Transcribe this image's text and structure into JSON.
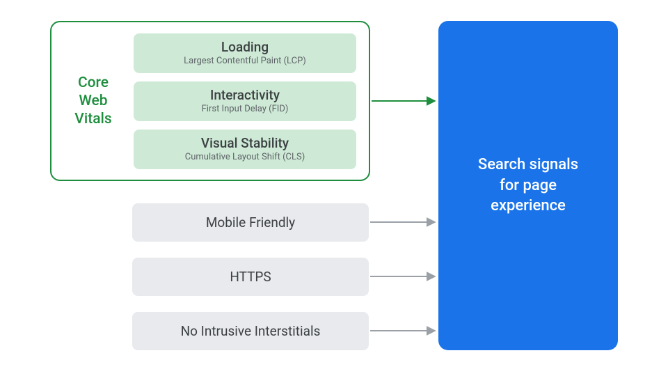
{
  "cwv": {
    "label_line1": "Core",
    "label_line2": "Web",
    "label_line3": "Vitals",
    "items": [
      {
        "title": "Loading",
        "sub": "Largest Contentful Paint (LCP)"
      },
      {
        "title": "Interactivity",
        "sub": "First Input Delay (FID)"
      },
      {
        "title": "Visual Stability",
        "sub": "Cumulative Layout Shift (CLS)"
      }
    ]
  },
  "signals": {
    "mobile": "Mobile Friendly",
    "https": "HTTPS",
    "interstitials": "No Intrusive Interstitials"
  },
  "target": {
    "line1": "Search signals",
    "line2": "for page",
    "line3": "experience"
  },
  "colors": {
    "green": "#1e8e3e",
    "mint": "#ceead6",
    "gray": "#e8eaed",
    "blue": "#1a73e8",
    "arrow_gray": "#9aa0a6"
  }
}
